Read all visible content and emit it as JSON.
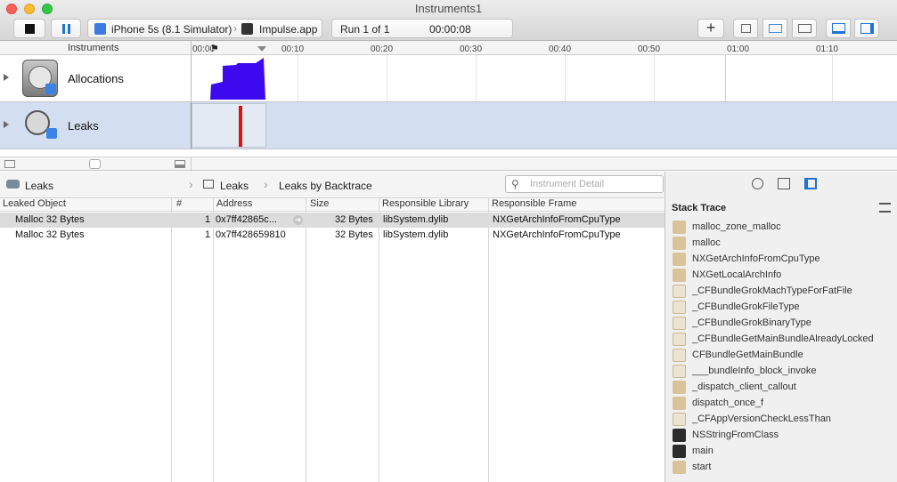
{
  "window": {
    "title": "Instruments1"
  },
  "toolbar": {
    "target_device": "iPhone 5s (8.1 Simulator)",
    "target_app": "Impulse.app",
    "run_label": "Run 1 of 1",
    "run_time": "00:00:08",
    "add_label": "+"
  },
  "timeline": {
    "header": "Instruments",
    "ticks": [
      "00:00",
      "00:10",
      "00:20",
      "00:30",
      "00:40",
      "00:50",
      "01:00",
      "01:10"
    ]
  },
  "instruments": [
    {
      "name": "Allocations"
    },
    {
      "name": "Leaks"
    }
  ],
  "jumpbar": {
    "instrument": "Leaks",
    "view": "Leaks",
    "detail": "Leaks by Backtrace",
    "search_placeholder": "Instrument Detail"
  },
  "table": {
    "columns": [
      "Leaked Object",
      "#",
      "Address",
      "Size",
      "Responsible Library",
      "Responsible Frame"
    ],
    "rows": [
      {
        "object": "Malloc 32 Bytes",
        "count": "1",
        "address": "0x7ff42865c...",
        "size": "32 Bytes",
        "library": "libSystem.dylib",
        "frame": "NXGetArchInfoFromCpuType"
      },
      {
        "object": "Malloc 32 Bytes",
        "count": "1",
        "address": "0x7ff428659810",
        "size": "32 Bytes",
        "library": "libSystem.dylib",
        "frame": "NXGetArchInfoFromCpuType"
      }
    ]
  },
  "stack_trace": {
    "title": "Stack Trace",
    "frames": [
      {
        "name": "malloc_zone_malloc",
        "kind": "library"
      },
      {
        "name": "malloc",
        "kind": "library"
      },
      {
        "name": "NXGetArchInfoFromCpuType",
        "kind": "library"
      },
      {
        "name": "NXGetLocalArchInfo",
        "kind": "library"
      },
      {
        "name": "_CFBundleGrokMachTypeForFatFile",
        "kind": "framework"
      },
      {
        "name": "_CFBundleGrokFileType",
        "kind": "framework"
      },
      {
        "name": "_CFBundleGrokBinaryType",
        "kind": "framework"
      },
      {
        "name": "_CFBundleGetMainBundleAlreadyLocked",
        "kind": "framework"
      },
      {
        "name": "CFBundleGetMainBundle",
        "kind": "framework"
      },
      {
        "name": "___bundleInfo_block_invoke",
        "kind": "framework"
      },
      {
        "name": "_dispatch_client_callout",
        "kind": "library"
      },
      {
        "name": "dispatch_once_f",
        "kind": "library"
      },
      {
        "name": "_CFAppVersionCheckLessThan",
        "kind": "framework"
      },
      {
        "name": "NSStringFromClass",
        "kind": "user"
      },
      {
        "name": "main",
        "kind": "user"
      },
      {
        "name": "start",
        "kind": "library"
      }
    ]
  },
  "colors": {
    "allocations_graph": "#3d0af0",
    "leak_marker": "#e01010",
    "selected_row": "#dcdcdc",
    "leaks_row_bg": "#d3dff0",
    "library_icon": "#d8c39a",
    "user_icon": "#2b2b2b"
  }
}
